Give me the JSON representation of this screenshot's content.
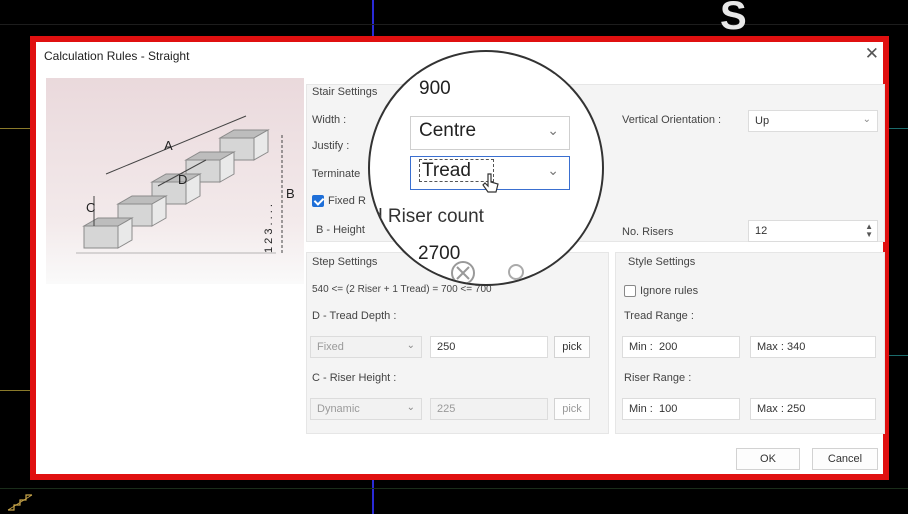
{
  "background": {
    "title_fragment": "S"
  },
  "dialog": {
    "title": "Calculation Rules - Straight",
    "close_glyph": "✕",
    "illustration_labels": {
      "a": "A",
      "d": "D",
      "c": "C",
      "b": "B",
      "ticks": "1  2  3  . . . ."
    },
    "stair_settings": {
      "heading": "Stair Settings",
      "width_label": "Width :",
      "justify_label": "Justify :",
      "terminate_label": "Terminate",
      "fixed_label": "Fixed R",
      "fixed_checked": true,
      "height_label": "B - Height",
      "vertical_orientation_label": "Vertical Orientation :",
      "vertical_orientation_value": "Up",
      "no_risers_label": "No. Risers",
      "no_risers_value": "12"
    },
    "step_settings": {
      "heading": "Step Settings",
      "formula": "540 <= (2 Riser + 1 Tread) = 700 <= 700",
      "tread_depth_label": "D - Tread Depth :",
      "tread_mode": "Fixed",
      "tread_value": "250",
      "tread_pick": "pick",
      "riser_height_label": "C - Riser Height :",
      "riser_mode": "Dynamic",
      "riser_value": "225",
      "riser_pick": "pick"
    },
    "style_settings": {
      "heading": "Style Settings",
      "ignore_rules_label": "Ignore rules",
      "ignore_rules_checked": false,
      "tread_range_label": "Tread Range :",
      "tread_min_label": "Min :",
      "tread_min": "200",
      "tread_max_label": "Max :",
      "tread_max": "340",
      "riser_range_label": "Riser Range :",
      "riser_min_label": "Min :",
      "riser_min": "100",
      "riser_max_label": "Max :",
      "riser_max": "250"
    },
    "ok_label": "OK",
    "cancel_label": "Cancel"
  },
  "magnifier": {
    "width_value": "900",
    "justify_value": "Centre",
    "terminate_value": "Tread",
    "riser_count_label": "d Riser count",
    "height_value": "2700"
  },
  "colors": {
    "highlight_border": "#e01010",
    "checkbox_accent": "#1e6fd8",
    "cad_axis_blue": "#2a2ad6"
  },
  "icons": [
    "close-icon",
    "chevron-down-icon",
    "spinner-icon",
    "cursor-icon",
    "cancel-circle-icon",
    "ring-icon",
    "stair-illustration"
  ]
}
